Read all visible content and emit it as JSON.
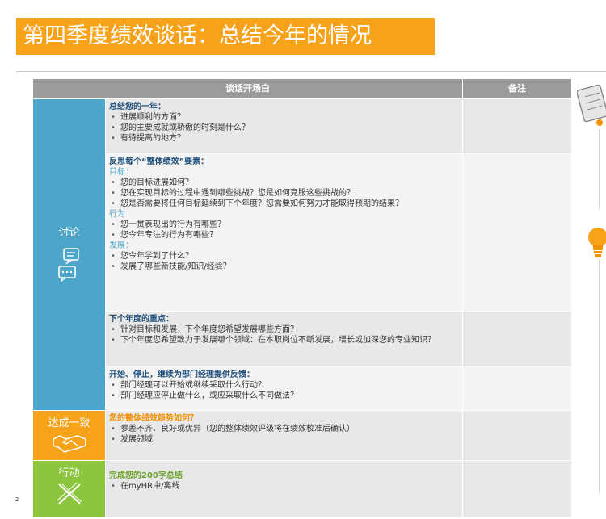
{
  "title": "第四季度绩效谈话：总结今年的情况",
  "page_number": "2",
  "table": {
    "header_main": "谈话开场白",
    "header_notes": "备注",
    "sections": {
      "discuss": {
        "label": "讨论",
        "icon": "chat-bubbles-icon",
        "blocks": [
          {
            "heading": "总结您的一年：",
            "items": [
              "进展顺利的方面？",
              "您的主要成就或骄傲的时刻是什么？",
              "有待提高的地方？"
            ]
          },
          {
            "heading": "反思每个“整体绩效”要素：",
            "groups": [
              {
                "label": "目标：",
                "items": [
                  "您的目标进展如何？",
                  "您在实现目标的过程中遇到哪些挑战？您是如何克服这些挑战的？",
                  "您是否需要将任何目标延续到下个年度？您需要如何努力才能取得预期的结果？"
                ]
              },
              {
                "label": "行为",
                "items": [
                  "您一贯表现出的行为有哪些？",
                  "您今年专注的行为有哪些？"
                ]
              },
              {
                "label": "发展：",
                "items": [
                  "您今年学到了什么？",
                  "发展了哪些新技能/知识/经验？"
                ]
              }
            ]
          },
          {
            "heading": "下个年度的重点：",
            "items": [
              "针对目标和发展，下个年度您希望发展哪些方面？",
              "下个年度您希望致力于发展哪个领域：在本职岗位不断发展，增长或加深您的专业知识？"
            ]
          },
          {
            "heading": "开始、停止，继续为部门经理提供反馈：",
            "items": [
              "部门经理可以开始或继续采取什么行动？",
              "部门经理应停止做什么，或应采取什么不同做法？"
            ]
          }
        ]
      },
      "agree": {
        "label": "达成一致",
        "icon": "handshake-icon",
        "heading": "您的整体绩效趋势如何？",
        "items": [
          "参差不齐、良好或优异（您的整体绩效评级将在绩效校准后确认）",
          "发展领域"
        ]
      },
      "act": {
        "label": "行动",
        "icon": "pencil-ruler-icon",
        "heading": "完成您的200字总结",
        "items": [
          "在myHR中/离线"
        ]
      }
    }
  },
  "colors": {
    "title_bg": "#f7a21b",
    "discuss": "#4ba6c9",
    "agree": "#f7a21b",
    "act": "#8cc63f",
    "header": "#9b9b9b"
  }
}
